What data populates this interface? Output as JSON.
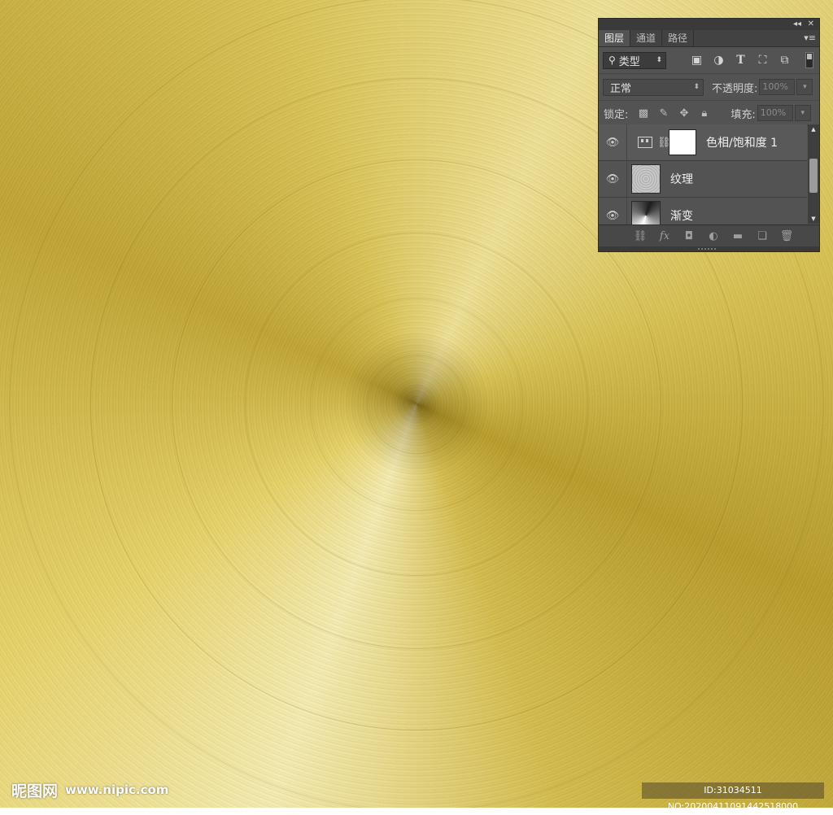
{
  "panel": {
    "topbar": {
      "collapse_icon": "collapse-icon",
      "close_icon": "close-icon"
    },
    "tabs": [
      {
        "label": "图层",
        "active": true
      },
      {
        "label": "通道",
        "active": false
      },
      {
        "label": "路径",
        "active": false
      }
    ],
    "filter": {
      "kind_label": "类型"
    },
    "blend": {
      "mode": "正常",
      "opacity_label": "不透明度:",
      "opacity_value": "100%"
    },
    "lock": {
      "label": "锁定:",
      "fill_label": "填充:",
      "fill_value": "100%"
    },
    "layers": [
      {
        "name": "色相/饱和度 1",
        "type": "adjustment",
        "visible": true
      },
      {
        "name": "纹理",
        "type": "texture",
        "visible": true
      },
      {
        "name": "渐变",
        "type": "gradient",
        "visible": true
      }
    ]
  },
  "watermark": {
    "logo_text": "昵图网",
    "url": "www.nipic.com",
    "id_text": "ID:31034511 NO:20200411091442518000"
  },
  "colors": {
    "gold_light": "#f6eeb8",
    "gold_mid": "#e0cc5e",
    "gold_dark": "#b79b2b",
    "panel_bg": "#535353"
  }
}
